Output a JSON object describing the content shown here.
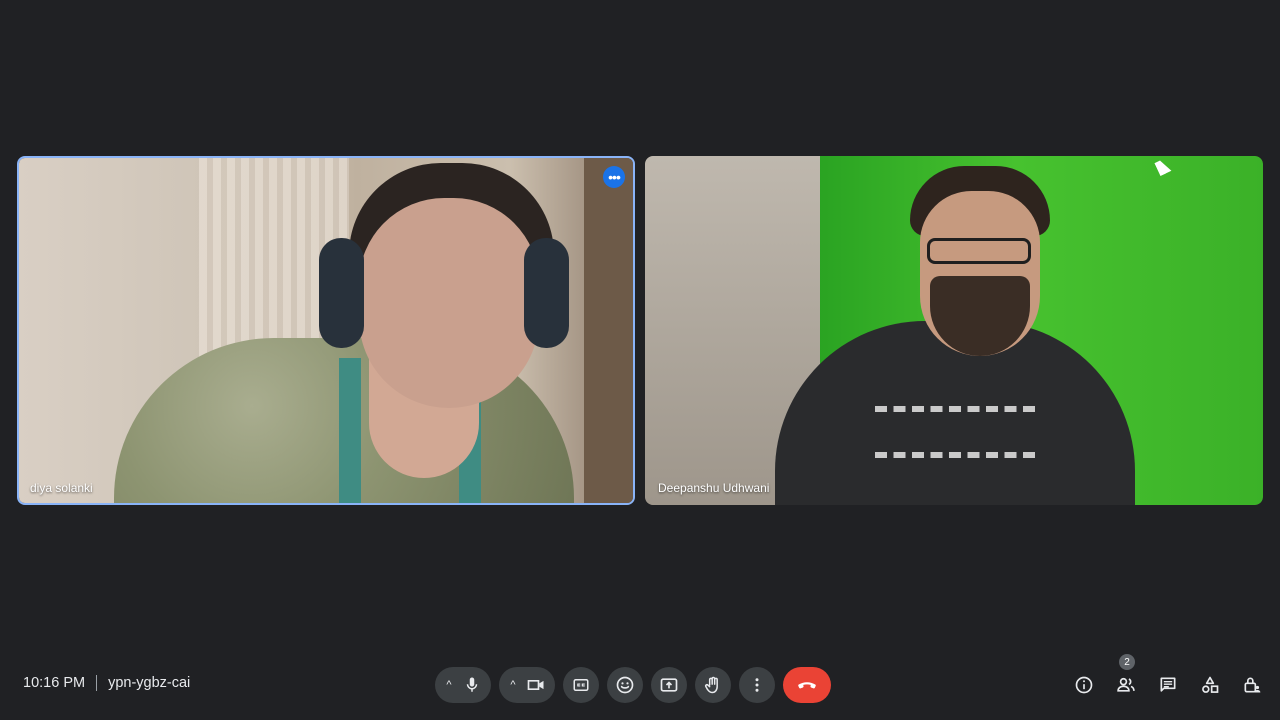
{
  "participants": [
    {
      "name": "diya solanki",
      "active_speaker": true,
      "more_button": "•••"
    },
    {
      "name": "Deepanshu Udhwani",
      "active_speaker": false
    }
  ],
  "meeting": {
    "time": "10:16 PM",
    "code": "ypn-ygbz-cai"
  },
  "controls": {
    "mic_caret": "^",
    "camera_caret": "^"
  },
  "people_count": "2",
  "colors": {
    "background": "#202124",
    "active_border": "#8ab4f8",
    "button_bg": "#3c4043",
    "end_call": "#ea4335"
  }
}
